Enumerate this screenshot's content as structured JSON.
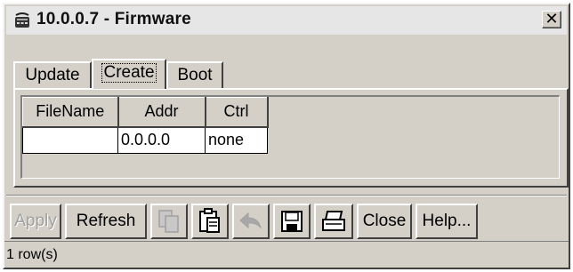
{
  "window": {
    "title": "10.0.0.7 - Firmware",
    "close_label": "✕"
  },
  "tabs": [
    {
      "label": "Update",
      "selected": false
    },
    {
      "label": "Create",
      "selected": true
    },
    {
      "label": "Boot",
      "selected": false
    }
  ],
  "table": {
    "columns": [
      "FileName",
      "Addr",
      "Ctrl"
    ],
    "rows": [
      {
        "filename": "",
        "addr": "0.0.0.0",
        "ctrl": "none"
      }
    ]
  },
  "toolbar": {
    "apply_label": "Apply",
    "refresh_label": "Refresh",
    "copy_icon": "copy-icon",
    "paste_icon": "paste-icon",
    "undo_icon": "undo-arrow-icon",
    "save_icon": "floppy-disk-icon",
    "print_icon": "printer-icon",
    "close_label": "Close",
    "help_label": "Help..."
  },
  "status": {
    "text": "1 row(s)"
  },
  "colors": {
    "window_bg": "#d4d0c8",
    "disabled_text": "#a0a0a0"
  }
}
